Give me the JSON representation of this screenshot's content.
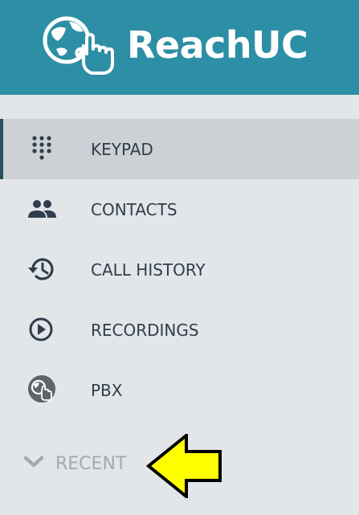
{
  "header": {
    "brand": "ReachUC",
    "logo_icon": "globe-hand-pointer-icon",
    "background_color": "#2d8fa5"
  },
  "nav": {
    "items": [
      {
        "label": "KEYPAD",
        "icon": "dialpad-icon",
        "active": true
      },
      {
        "label": "CONTACTS",
        "icon": "people-icon",
        "active": false
      },
      {
        "label": "CALL HISTORY",
        "icon": "history-icon",
        "active": false
      },
      {
        "label": "RECORDINGS",
        "icon": "play-circle-icon",
        "active": false
      },
      {
        "label": "PBX",
        "icon": "pbx-logo-icon",
        "active": false
      }
    ]
  },
  "recent": {
    "label": "RECENT",
    "icon": "chevron-down-icon",
    "expanded": false
  },
  "annotation": {
    "icon": "yellow-arrow-icon",
    "color": "#ffff00"
  }
}
